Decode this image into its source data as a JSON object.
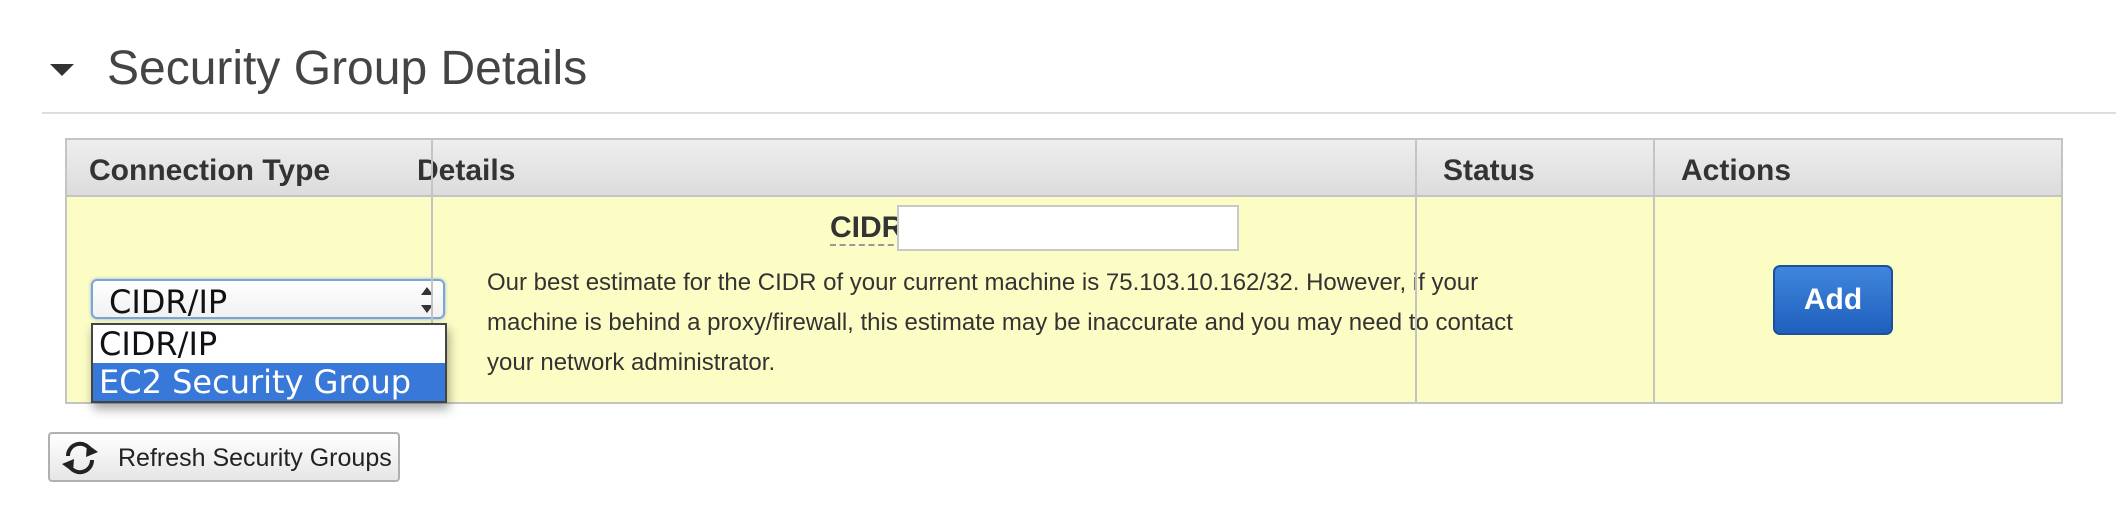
{
  "section": {
    "title": "Security Group Details"
  },
  "table": {
    "headers": {
      "connection_type": "Connection Type",
      "details": "Details",
      "status": "Status",
      "actions": "Actions"
    },
    "row": {
      "connection_select": {
        "value": "CIDR/IP",
        "options": [
          "CIDR/IP",
          "EC2 Security Group"
        ],
        "highlighted_option": "EC2 Security Group"
      },
      "cidr": {
        "label": "CIDR:",
        "value": "",
        "placeholder": ""
      },
      "details_text": "Our best estimate for the CIDR of your current machine is 75.103.10.162/32. However, if your machine is behind a proxy/firewall, this estimate may be inaccurate and you may need to contact your network administrator.",
      "status": "",
      "add_label": "Add"
    }
  },
  "refresh_button": {
    "label": "Refresh Security Groups",
    "icon": "refresh-icon"
  },
  "colors": {
    "row_background": "#fcfcc5",
    "header_background": "#e4e4e4",
    "accent_blue": "#2a6fcf",
    "selection_blue": "#3878d8"
  }
}
